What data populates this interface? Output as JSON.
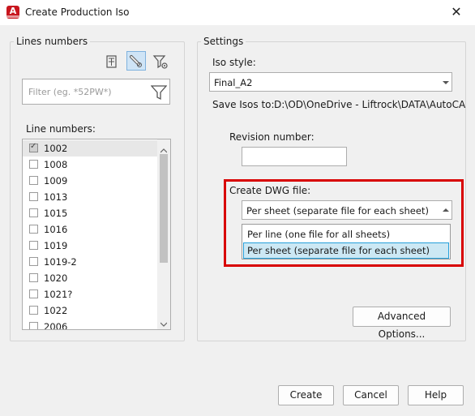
{
  "window": {
    "title": "Create Production Iso",
    "app_icon": "autocad-icon",
    "close_glyph": "✕"
  },
  "lines_panel": {
    "group_title": "Lines numbers",
    "filter_placeholder": "Filter (eg. *52PW*)",
    "list_label": "Line numbers:",
    "items": [
      {
        "label": "1002",
        "checked": true
      },
      {
        "label": "1008",
        "checked": false
      },
      {
        "label": "1009",
        "checked": false
      },
      {
        "label": "1013",
        "checked": false
      },
      {
        "label": "1015",
        "checked": false
      },
      {
        "label": "1016",
        "checked": false
      },
      {
        "label": "1019",
        "checked": false
      },
      {
        "label": "1019-2",
        "checked": false
      },
      {
        "label": "1020",
        "checked": false
      },
      {
        "label": "1021?",
        "checked": false
      },
      {
        "label": "1022",
        "checked": false
      },
      {
        "label": "2006",
        "checked": false
      }
    ]
  },
  "settings": {
    "group_title": "Settings",
    "iso_style_label": "Iso style:",
    "iso_style_value": "Final_A2",
    "save_isos_label": "Save Isos to:",
    "save_isos_path": "D:\\OD\\OneDrive - Liftrock\\DATA\\AutoCA",
    "revision_label": "Revision number:",
    "revision_value": "",
    "create_dwg_label": "Create DWG file:",
    "create_dwg_value": "Per sheet (separate file for each sheet)",
    "create_dwg_options": [
      "Per line (one file for all sheets)",
      "Per sheet (separate file for each sheet)"
    ],
    "advanced_button": "Advanced Options..."
  },
  "buttons": {
    "create": "Create",
    "cancel": "Cancel",
    "help": "Help"
  },
  "colors": {
    "highlight": "#d80000",
    "selection": "#cce8f4",
    "accent": "#26a0da"
  }
}
